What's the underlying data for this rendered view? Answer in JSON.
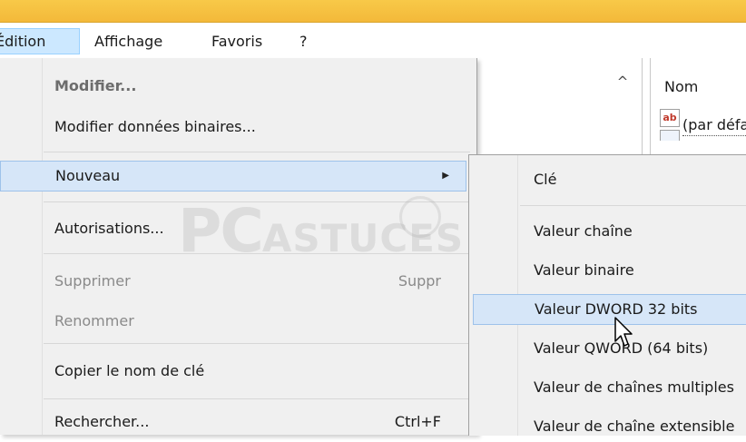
{
  "menubar": {
    "items": [
      {
        "label": "Édition",
        "active": true
      },
      {
        "label": "Affichage",
        "active": false
      },
      {
        "label": "Favoris",
        "active": false
      },
      {
        "label": "?",
        "active": false
      }
    ]
  },
  "background": {
    "list_header": "Nom",
    "list_value": "(par défaut)",
    "value_icon": "ab"
  },
  "context_menu": {
    "modify": "Modifier...",
    "modify_binary": "Modifier données binaires...",
    "new": "Nouveau",
    "permissions": "Autorisations...",
    "delete": "Supprimer",
    "delete_shortcut": "Suppr",
    "rename": "Renommer",
    "copy_key_name": "Copier le nom de clé",
    "find": "Rechercher...",
    "find_shortcut": "Ctrl+F"
  },
  "submenu_new": {
    "key": "Clé",
    "string_value": "Valeur chaîne",
    "binary_value": "Valeur binaire",
    "dword_value": "Valeur DWORD 32 bits",
    "qword_value": "Valeur QWORD (64 bits)",
    "multi_string_value": "Valeur de chaînes multiples",
    "expandable_string_value": "Valeur de chaîne extensible"
  },
  "watermark": {
    "text_big": "PC",
    "text_small": "ASTUCES"
  },
  "colors": {
    "title_bar": "#f3b93a",
    "highlight": "#d6e6f8",
    "highlight_border": "#9ec2ea"
  }
}
